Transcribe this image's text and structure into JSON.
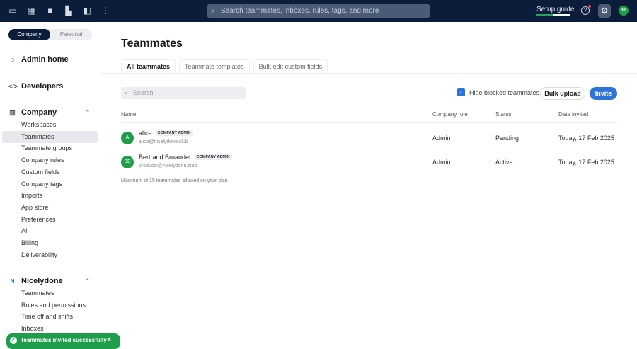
{
  "topbar": {
    "search_placeholder": "Search teammates, inboxes, rules, tags, and more",
    "setup_guide": "Setup guide",
    "setup_progress": 0.5,
    "avatar": "BB"
  },
  "sidebar": {
    "toggle": {
      "company": "Company",
      "personal": "Personal"
    },
    "admin_home": "Admin home",
    "developers": "Developers",
    "company": "Company",
    "company_items": [
      "Workspaces",
      "Teammates",
      "Teammate groups",
      "Company rules",
      "Custom fields",
      "Company tags",
      "Imports",
      "App store",
      "Preferences",
      "AI",
      "Billing",
      "Deliverability"
    ],
    "workspace": {
      "initial": "N",
      "name": "Nicelydone",
      "items": [
        "Teammates",
        "Roles and permissions",
        "Time off and shifts",
        "Inboxes"
      ]
    }
  },
  "main": {
    "title": "Teammates",
    "tabs": [
      "All teammates",
      "Teammate templates",
      "Bulk edit custom fields"
    ],
    "search_placeholder": "Search",
    "hide_blocked": "Hide blocked teammates",
    "bulk_upload": "Bulk upload",
    "invite": "Invite",
    "columns": [
      "Name",
      "Company role",
      "Status",
      "Date invited"
    ],
    "rows": [
      {
        "initials": "A",
        "name": "alice",
        "badge": "COMPANY ADMIN",
        "email": "alice@nicelydone.club",
        "role": "Admin",
        "status": "Pending",
        "date": "Today, 17 Feb 2025"
      },
      {
        "initials": "BB",
        "name": "Bertrand Bruandet",
        "badge": "COMPANY ADMIN",
        "email": "products@nicelydone.club",
        "role": "Admin",
        "status": "Active",
        "date": "Today, 17 Feb 2025"
      }
    ],
    "note": "Maximum of 15 teammates allowed on your plan"
  },
  "toast": {
    "message": "Teammates invited successfully"
  }
}
